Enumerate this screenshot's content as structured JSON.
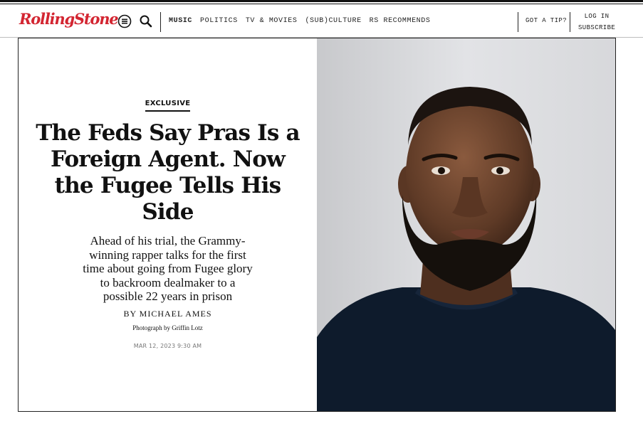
{
  "header": {
    "logo": "RollingStone",
    "nav": [
      "MUSIC",
      "POLITICS",
      "TV & MOVIES",
      "(SUB)CULTURE",
      "RS RECOMMENDS"
    ],
    "tip": "GOT A TIP?",
    "login": "LOG IN",
    "subscribe": "SUBSCRIBE"
  },
  "article": {
    "kicker": "EXCLUSIVE",
    "headline": "The Feds Say Pras Is a Foreign Agent. Now the Fugee Tells His Side",
    "dek": "Ahead of his trial, the Grammy-winning rapper talks for the first time about going from Fugee glory to backroom dealmaker to a possible 22 years in prison",
    "byline": "BY MICHAEL AMES",
    "photo_credit": "Photograph by Griffin Lotz",
    "date": "MAR 12, 2023 9:30 AM"
  },
  "colors": {
    "brand": "#d32531",
    "text": "#111111",
    "muted": "#777777"
  },
  "icons": [
    "menu-icon",
    "search-icon"
  ]
}
